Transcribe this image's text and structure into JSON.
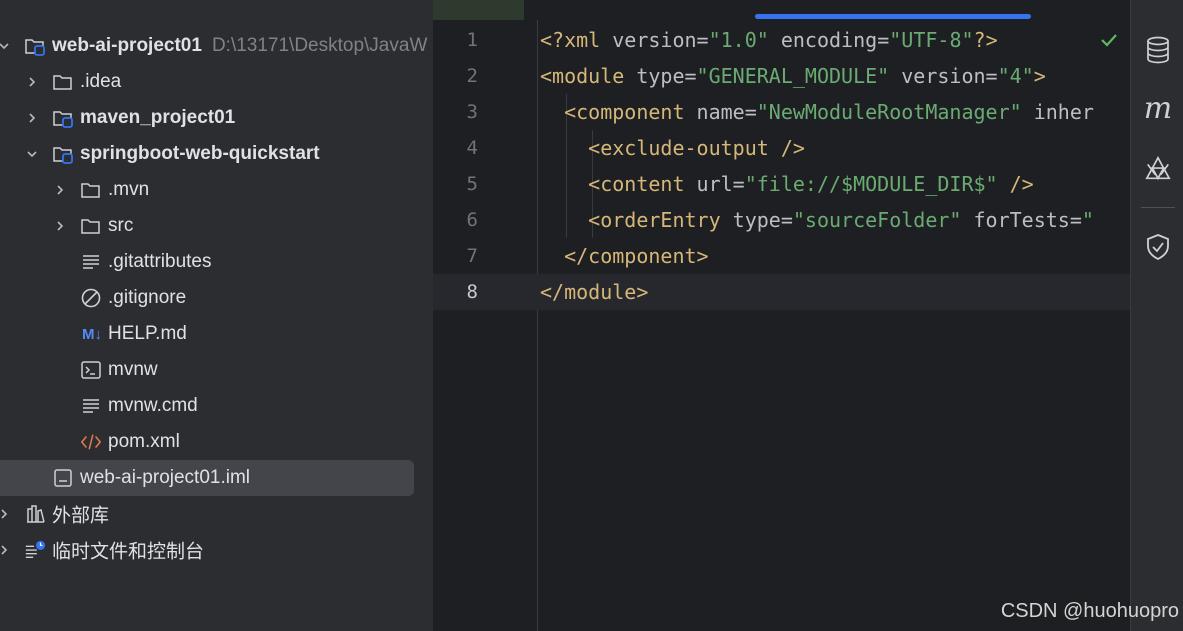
{
  "project_tree": {
    "root": {
      "name": "web-ai-project01",
      "path": "D:\\13171\\Desktop\\JavaW"
    },
    "items": [
      {
        "label": ".idea"
      },
      {
        "label": "maven_project01"
      },
      {
        "label": "springboot-web-quickstart"
      },
      {
        "label": ".mvn"
      },
      {
        "label": "src"
      },
      {
        "label": ".gitattributes"
      },
      {
        "label": ".gitignore"
      },
      {
        "label": "HELP.md",
        "badge": "M↓"
      },
      {
        "label": "mvnw"
      },
      {
        "label": "mvnw.cmd"
      },
      {
        "label": "pom.xml"
      },
      {
        "label": "web-ai-project01.iml"
      }
    ],
    "external_libraries": "外部库",
    "scratches": "临时文件和控制台"
  },
  "editor": {
    "line_numbers": [
      "1",
      "2",
      "3",
      "4",
      "5",
      "6",
      "7",
      "8"
    ],
    "current_line": 8,
    "lines": [
      [
        {
          "t": "tag",
          "v": "<?xml "
        },
        {
          "t": "attr",
          "v": "version"
        },
        {
          "t": "pun",
          "v": "="
        },
        {
          "t": "str",
          "v": "\"1.0\""
        },
        {
          "t": "attr",
          "v": " encoding"
        },
        {
          "t": "pun",
          "v": "="
        },
        {
          "t": "str",
          "v": "\"UTF-8\""
        },
        {
          "t": "tag",
          "v": "?>"
        }
      ],
      [
        {
          "t": "tag",
          "v": "<module "
        },
        {
          "t": "attr",
          "v": "type"
        },
        {
          "t": "pun",
          "v": "="
        },
        {
          "t": "str",
          "v": "\"GENERAL_MODULE\""
        },
        {
          "t": "attr",
          "v": " version"
        },
        {
          "t": "pun",
          "v": "="
        },
        {
          "t": "str",
          "v": "\"4\""
        },
        {
          "t": "tag",
          "v": ">"
        }
      ],
      [
        {
          "t": "pun",
          "v": "  "
        },
        {
          "t": "tag",
          "v": "<component "
        },
        {
          "t": "attr",
          "v": "name"
        },
        {
          "t": "pun",
          "v": "="
        },
        {
          "t": "str",
          "v": "\"NewModuleRootManager\""
        },
        {
          "t": "attr",
          "v": " inher"
        }
      ],
      [
        {
          "t": "pun",
          "v": "    "
        },
        {
          "t": "tag",
          "v": "<exclude-output />"
        }
      ],
      [
        {
          "t": "pun",
          "v": "    "
        },
        {
          "t": "tag",
          "v": "<content "
        },
        {
          "t": "attr",
          "v": "url"
        },
        {
          "t": "pun",
          "v": "="
        },
        {
          "t": "str",
          "v": "\"file://$MODULE_DIR$\""
        },
        {
          "t": "tag",
          "v": " />"
        }
      ],
      [
        {
          "t": "pun",
          "v": "    "
        },
        {
          "t": "tag",
          "v": "<orderEntry "
        },
        {
          "t": "attr",
          "v": "type"
        },
        {
          "t": "pun",
          "v": "="
        },
        {
          "t": "str",
          "v": "\"sourceFolder\""
        },
        {
          "t": "attr",
          "v": " forTests"
        },
        {
          "t": "pun",
          "v": "="
        },
        {
          "t": "str",
          "v": "\""
        }
      ],
      [
        {
          "t": "pun",
          "v": "  "
        },
        {
          "t": "tag",
          "v": "</component>"
        }
      ],
      [
        {
          "t": "tag",
          "v": "</module>"
        }
      ]
    ]
  },
  "right_toolbar": {
    "icons": [
      "database-icon",
      "maven-icon",
      "ai-assistant-icon",
      "security-shield-icon"
    ],
    "maven_glyph": "m"
  },
  "watermark": "CSDN @huohuopro",
  "colors": {
    "tag": "#d5b778",
    "string": "#6aab73",
    "accent": "#3574f0",
    "check": "#5fb865"
  }
}
